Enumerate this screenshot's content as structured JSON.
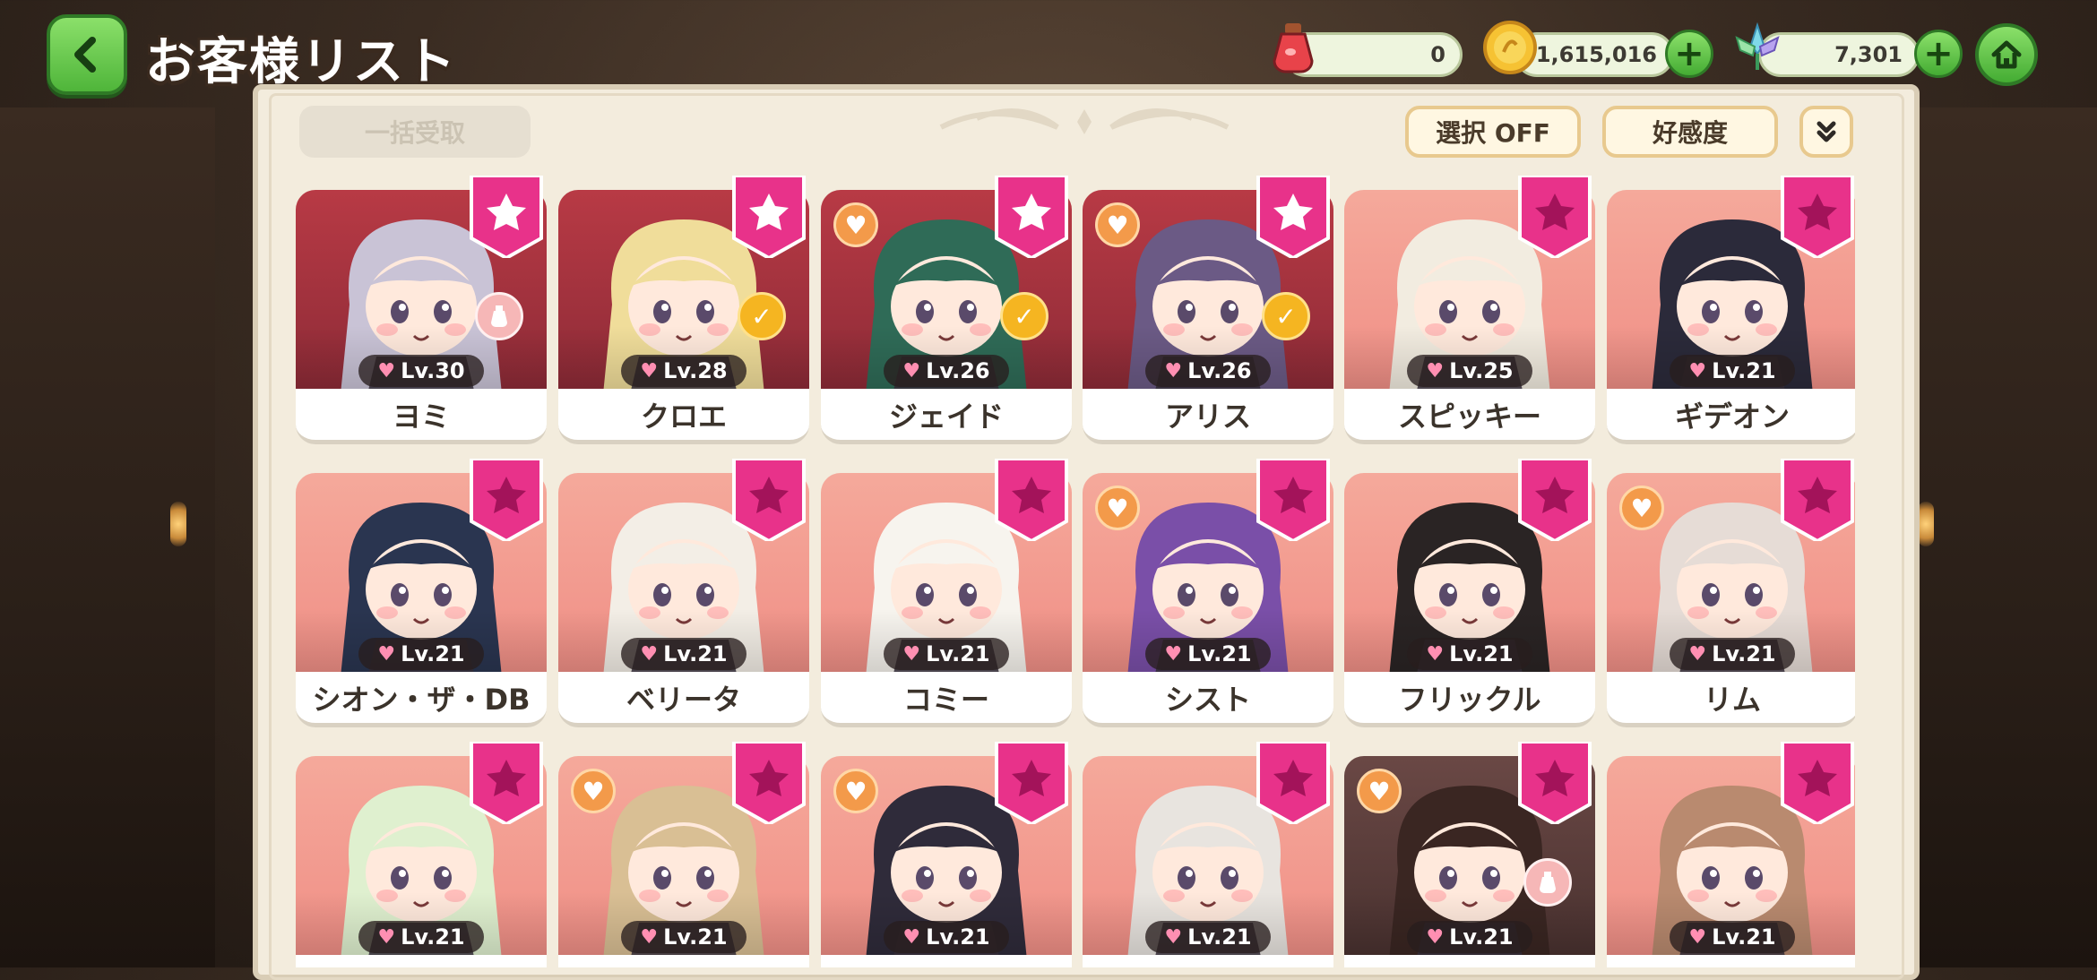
{
  "header": {
    "title": "お客様リスト",
    "back_icon": "chevron-left-icon",
    "home_icon": "home-icon"
  },
  "resources": [
    {
      "icon": "potion-icon",
      "value": "0",
      "has_plus": false
    },
    {
      "icon": "gold-coin-icon",
      "value": "1,615,016",
      "has_plus": true
    },
    {
      "icon": "crystal-flower-icon",
      "value": "7,301",
      "has_plus": true
    }
  ],
  "toolbar": {
    "collect_all_label": "一括受取",
    "select_label": "選択 OFF",
    "sort_label": "好感度",
    "expand_icon": "double-chevron-down-icon"
  },
  "colors": {
    "accent_green": "#5cc443",
    "ribbon_pink": "#e8328a",
    "card_bg_pink": "#f5a99b",
    "card_bg_red": "#b83a45",
    "badge_orange": "#f39a4a"
  },
  "customers": [
    {
      "name": "ヨミ",
      "level": "Lv.30",
      "ribbon": "star",
      "orange_heart": false,
      "corner_badge": "potion",
      "bg": "red",
      "hair": "#c9c3d6"
    },
    {
      "name": "クロエ",
      "level": "Lv.28",
      "ribbon": "star",
      "orange_heart": false,
      "corner_badge": "gift",
      "bg": "red",
      "hair": "#f0dd9a"
    },
    {
      "name": "ジェイド",
      "level": "Lv.26",
      "ribbon": "star",
      "orange_heart": true,
      "corner_badge": "gift",
      "bg": "red",
      "hair": "#2f6b57"
    },
    {
      "name": "アリス",
      "level": "Lv.26",
      "ribbon": "star",
      "orange_heart": true,
      "corner_badge": "gift",
      "bg": "red",
      "hair": "#6b5a85"
    },
    {
      "name": "スピッキー",
      "level": "Lv.25",
      "ribbon": "dark",
      "orange_heart": false,
      "corner_badge": "none",
      "bg": "pink",
      "hair": "#f2ece0"
    },
    {
      "name": "ギデオン",
      "level": "Lv.21",
      "ribbon": "dark",
      "orange_heart": false,
      "corner_badge": "none",
      "bg": "pink",
      "hair": "#2b2a3a"
    },
    {
      "name": "シオン・ザ・DB",
      "level": "Lv.21",
      "ribbon": "dark",
      "orange_heart": false,
      "corner_badge": "none",
      "bg": "pink",
      "hair": "#2a3550"
    },
    {
      "name": "ベリータ",
      "level": "Lv.21",
      "ribbon": "dark",
      "orange_heart": false,
      "corner_badge": "none",
      "bg": "pink",
      "hair": "#f3eee6"
    },
    {
      "name": "コミー",
      "level": "Lv.21",
      "ribbon": "dark",
      "orange_heart": false,
      "corner_badge": "none",
      "bg": "pink",
      "hair": "#f7f4ee"
    },
    {
      "name": "シスト",
      "level": "Lv.21",
      "ribbon": "dark",
      "orange_heart": true,
      "corner_badge": "none",
      "bg": "pink",
      "hair": "#7a4fa8"
    },
    {
      "name": "フリックル",
      "level": "Lv.21",
      "ribbon": "dark",
      "orange_heart": false,
      "corner_badge": "none",
      "bg": "pink",
      "hair": "#2a2424"
    },
    {
      "name": "リム",
      "level": "Lv.21",
      "ribbon": "dark",
      "orange_heart": true,
      "corner_badge": "none",
      "bg": "pink",
      "hair": "#e6dcd6"
    },
    {
      "name": "",
      "level": "Lv.21",
      "ribbon": "dark",
      "orange_heart": false,
      "corner_badge": "none",
      "bg": "pink",
      "hair": "#dff0cf"
    },
    {
      "name": "",
      "level": "Lv.21",
      "ribbon": "dark",
      "orange_heart": true,
      "corner_badge": "none",
      "bg": "pink",
      "hair": "#d9bf94"
    },
    {
      "name": "",
      "level": "Lv.21",
      "ribbon": "dark",
      "orange_heart": true,
      "corner_badge": "none",
      "bg": "pink",
      "hair": "#2f2b3a"
    },
    {
      "name": "",
      "level": "Lv.21",
      "ribbon": "dark",
      "orange_heart": false,
      "corner_badge": "none",
      "bg": "pink",
      "hair": "#e8e4df"
    },
    {
      "name": "",
      "level": "Lv.21",
      "ribbon": "dark",
      "orange_heart": true,
      "corner_badge": "potion",
      "bg": "dark",
      "hair": "#3a2622"
    },
    {
      "name": "",
      "level": "Lv.21",
      "ribbon": "dark",
      "orange_heart": false,
      "corner_badge": "none",
      "bg": "pink",
      "hair": "#b98a6f"
    }
  ]
}
